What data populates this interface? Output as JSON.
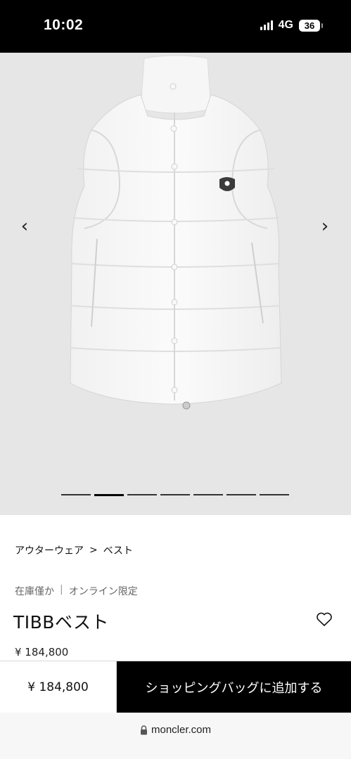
{
  "status_bar": {
    "time": "10:02",
    "network": "4G",
    "battery": "36"
  },
  "gallery": {
    "prev_icon": "chevron-left-icon",
    "next_icon": "chevron-right-icon",
    "image_count": 7,
    "active_index": 1,
    "prev_glyph": "‹",
    "next_glyph": "›"
  },
  "breadcrumb": {
    "category": "アウターウェア",
    "separator": ">",
    "subcategory": "ベスト"
  },
  "availability": {
    "stock": "在庫僅か",
    "divider": "|",
    "channel": "オンライン限定"
  },
  "product": {
    "title": "TIBBベスト",
    "price": "¥ 184,800"
  },
  "sticky_bar": {
    "price": "¥ 184,800",
    "cart_label": "ショッピングバッグに追加する"
  },
  "browser": {
    "url": "moncler.com"
  },
  "colors": {
    "status_bg": "#000000",
    "gallery_bg": "#e6e6e6",
    "cta_bg": "#000000",
    "cta_text": "#ffffff"
  }
}
